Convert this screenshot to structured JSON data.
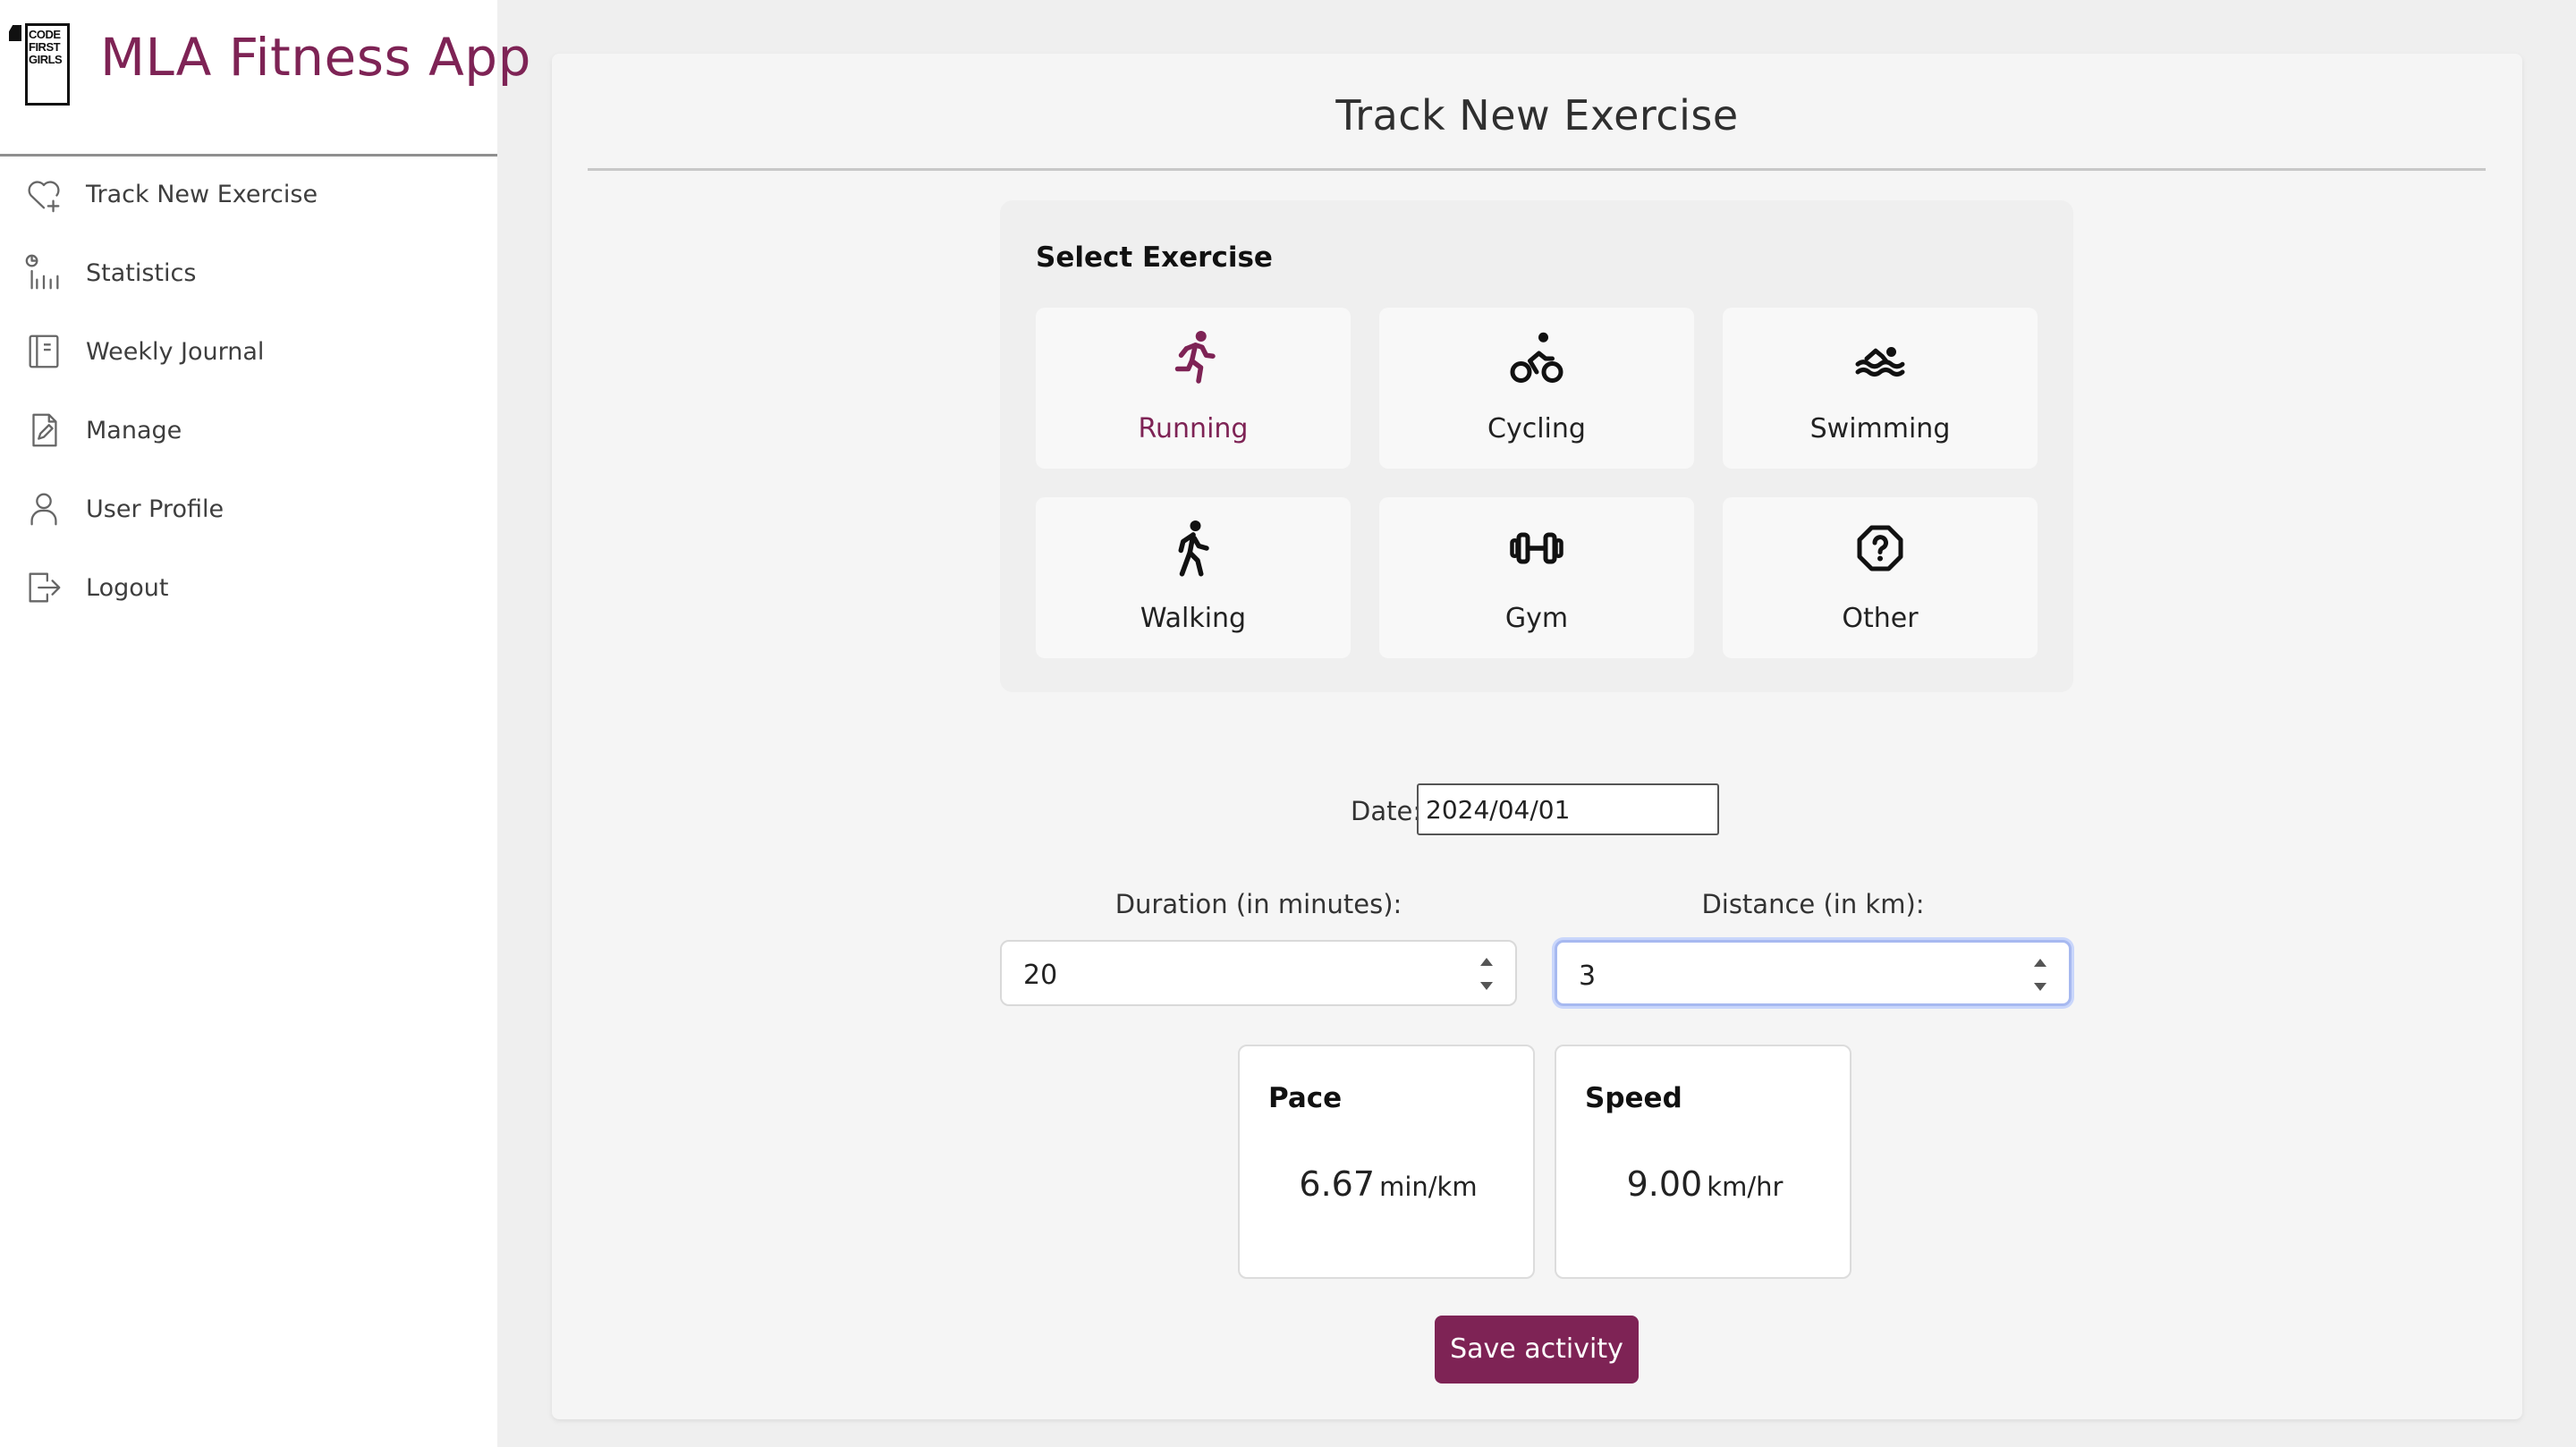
{
  "app": {
    "title": "MLA Fitness App",
    "logo_text": "CODE FIRST GIRLS",
    "brand_color": "#7e2355"
  },
  "sidebar": {
    "items": [
      {
        "label": "Track New Exercise",
        "icon": "heart-plus-icon"
      },
      {
        "label": "Statistics",
        "icon": "statistics-icon"
      },
      {
        "label": "Weekly Journal",
        "icon": "journal-icon"
      },
      {
        "label": "Manage",
        "icon": "edit-document-icon"
      },
      {
        "label": "User Profile",
        "icon": "user-icon"
      },
      {
        "label": "Logout",
        "icon": "logout-icon"
      }
    ]
  },
  "main": {
    "title": "Track New Exercise",
    "select_heading": "Select Exercise",
    "exercises": [
      {
        "label": "Running",
        "icon": "running-icon",
        "selected": true
      },
      {
        "label": "Cycling",
        "icon": "cycling-icon",
        "selected": false
      },
      {
        "label": "Swimming",
        "icon": "swimming-icon",
        "selected": false
      },
      {
        "label": "Walking",
        "icon": "walking-icon",
        "selected": false
      },
      {
        "label": "Gym",
        "icon": "dumbbell-icon",
        "selected": false
      },
      {
        "label": "Other",
        "icon": "question-icon",
        "selected": false
      }
    ],
    "form": {
      "date_label": "Date:",
      "date_value": "2024/04/01",
      "duration_label": "Duration (in minutes):",
      "duration_value": "20",
      "distance_label": "Distance (in km):",
      "distance_value": "3"
    },
    "stats": {
      "pace_label": "Pace",
      "pace_value": "6.67",
      "pace_unit": "min/km",
      "speed_label": "Speed",
      "speed_value": "9.00",
      "speed_unit": "km/hr"
    },
    "save_label": "Save activity"
  }
}
